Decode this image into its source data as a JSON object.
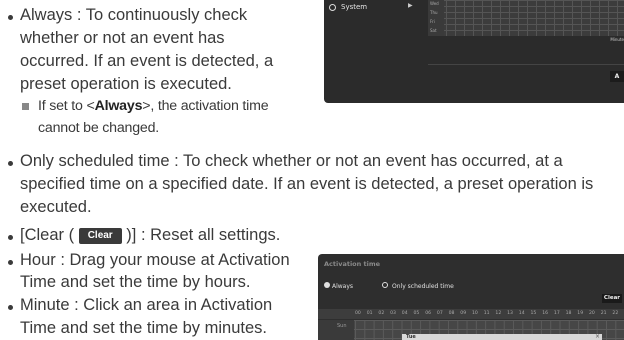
{
  "items": {
    "always": {
      "lines": [
        "Always : To continuously check",
        "whether or not an event has",
        "occurred. If an event is detected, a",
        "preset operation is executed."
      ],
      "note_prefix": "If set to <",
      "note_bold": "Always",
      "note_suffix": ">, the activation time",
      "note_line2": "cannot be changed."
    },
    "scheduled": {
      "lines": [
        "Only scheduled time : To check whether or not an event has occurred, at a",
        "specified time on a specified date. If an event is detected, a preset operation is",
        "executed."
      ]
    },
    "clear": {
      "prefix": "[Clear (",
      "button": "Clear",
      "suffix": ")] : Reset all settings."
    },
    "hour": {
      "lines": [
        "Hour : Drag your mouse at Activation",
        "Time and set the time by hours."
      ]
    },
    "minute": {
      "lines": [
        "Minute : Click an area in Activation",
        "Time and set the time by minutes."
      ]
    }
  },
  "panel1": {
    "menu_label": "System",
    "row_labels": [
      "Wed",
      "Thu",
      "Fri",
      "Sat"
    ],
    "minute_label": "Minute",
    "apply_label": "A"
  },
  "panel2": {
    "title": "Activation time",
    "radio_always": "Always",
    "radio_scheduled": "Only scheduled time",
    "clear_label": "Clear",
    "hours": [
      "00",
      "01",
      "02",
      "03",
      "04",
      "05",
      "06",
      "07",
      "08",
      "09",
      "10",
      "11",
      "12",
      "13",
      "14",
      "15",
      "16",
      "17",
      "18",
      "19",
      "20",
      "21",
      "22"
    ],
    "row_label": "Sun",
    "popup_title": "Tue",
    "popup_close": "×"
  },
  "colors": {
    "text": "#3a3a3a",
    "panel_bg": "#2b2b2b",
    "button_bg": "#3a3a3a"
  }
}
